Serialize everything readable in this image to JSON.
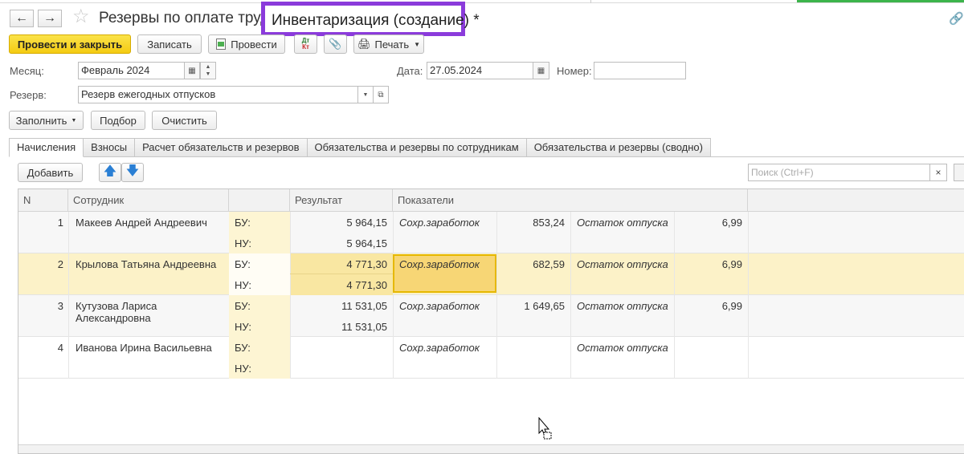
{
  "window": {
    "title_prefix": "Резервы по оплате труда",
    "title_highlight": "Инвентаризация (создание) *"
  },
  "toolbar": {
    "post_close": "Провести и закрыть",
    "save": "Записать",
    "post": "Провести",
    "dtkt_top": "Дт",
    "dtkt_bottom": "Кт",
    "print": "Печать"
  },
  "form": {
    "month_label": "Месяц:",
    "month_value": "Февраль 2024",
    "date_label": "Дата:",
    "date_value": "27.05.2024",
    "number_label": "Номер:",
    "number_value": "",
    "reserve_label": "Резерв:",
    "reserve_value": "Резерв ежегодных отпусков"
  },
  "actions": {
    "fill": "Заполнить",
    "select": "Подбор",
    "clear": "Очистить"
  },
  "tabs": [
    {
      "label": "Начисления",
      "active": true
    },
    {
      "label": "Взносы",
      "active": false
    },
    {
      "label": "Расчет обязательств и резервов",
      "active": false
    },
    {
      "label": "Обязательства и резервы по сотрудникам",
      "active": false
    },
    {
      "label": "Обязательства и резервы (сводно)",
      "active": false
    }
  ],
  "table_toolbar": {
    "add": "Добавить",
    "search_placeholder": "Поиск (Ctrl+F)",
    "search_clear": "×"
  },
  "table": {
    "headers": {
      "n": "N",
      "employee": "Сотрудник",
      "result": "Результат",
      "indicators": "Показатели"
    },
    "rows": [
      {
        "n": "1",
        "name1": "Макеев Андрей Андреевич",
        "name2": "",
        "bu": "БУ:",
        "nu": "НУ:",
        "res_bu": "5 964,15",
        "res_nu": "5 964,15",
        "ind1": "Сохр.заработок",
        "val1": "853,24",
        "ind2": "Остаток отпуска",
        "val2": "6,99"
      },
      {
        "n": "2",
        "name1": "Крылова Татьяна Андреевна",
        "name2": "",
        "bu": "БУ:",
        "nu": "НУ:",
        "res_bu": "4 771,30",
        "res_nu": "4 771,30",
        "ind1": "Сохр.заработок",
        "val1": "682,59",
        "ind2": "Остаток отпуска",
        "val2": "6,99"
      },
      {
        "n": "3",
        "name1": "Кутузова Лариса",
        "name2": "Александровна",
        "bu": "БУ:",
        "nu": "НУ:",
        "res_bu": "11 531,05",
        "res_nu": "11 531,05",
        "ind1": "Сохр.заработок",
        "val1": "1 649,65",
        "ind2": "Остаток отпуска",
        "val2": "6,99"
      },
      {
        "n": "4",
        "name1": "Иванова Ирина Васильевна",
        "name2": "",
        "bu": "БУ:",
        "nu": "НУ:",
        "res_bu": "",
        "res_nu": "",
        "ind1": "Сохр.заработок",
        "val1": "",
        "ind2": "Остаток отпуска",
        "val2": ""
      }
    ],
    "selected_row": 1
  },
  "colors": {
    "accent_yellow": "#f4cb12",
    "highlight_purple": "#8b3bdb",
    "selected_row": "#fcf2c8",
    "active_green": "#3cb44b"
  }
}
